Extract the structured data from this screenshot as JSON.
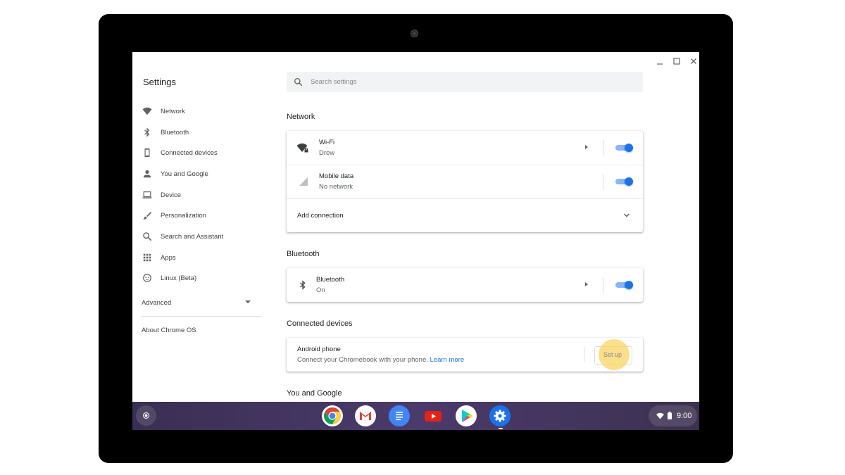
{
  "window": {
    "app_title": "Settings",
    "controls": [
      "minimize-icon",
      "maximize-icon",
      "close-icon"
    ]
  },
  "sidebar": {
    "items": [
      {
        "label": "Network",
        "icon": "wifi-icon"
      },
      {
        "label": "Bluetooth",
        "icon": "bluetooth-icon"
      },
      {
        "label": "Connected devices",
        "icon": "phone-icon"
      },
      {
        "label": "You and Google",
        "icon": "person-icon"
      },
      {
        "label": "Device",
        "icon": "laptop-icon"
      },
      {
        "label": "Personalization",
        "icon": "brush-icon"
      },
      {
        "label": "Search and Assistant",
        "icon": "search-icon"
      },
      {
        "label": "Apps",
        "icon": "apps-grid-icon"
      },
      {
        "label": "Linux (Beta)",
        "icon": "linux-icon"
      }
    ],
    "advanced_label": "Advanced",
    "about_label": "About Chrome OS"
  },
  "search": {
    "placeholder": "Search settings"
  },
  "sections": {
    "network": {
      "title": "Network",
      "wifi": {
        "title": "Wi-Fi",
        "subtitle": "Drew",
        "enabled": true
      },
      "mobile": {
        "title": "Mobile data",
        "subtitle": "No network",
        "enabled": true
      },
      "add_connection": "Add connection"
    },
    "bluetooth": {
      "title": "Bluetooth",
      "row": {
        "title": "Bluetooth",
        "subtitle": "On",
        "enabled": true
      }
    },
    "connected_devices": {
      "title": "Connected devices",
      "android": {
        "title": "Android phone",
        "subtitle": "Connect your Chromebook with your phone.",
        "link": "Learn more",
        "button": "Set up"
      }
    },
    "you_and_google": {
      "title": "You and Google"
    }
  },
  "shelf": {
    "apps": [
      "chrome-icon",
      "gmail-icon",
      "docs-icon",
      "youtube-icon",
      "play-store-icon",
      "settings-gear-icon"
    ],
    "time": "9:00",
    "colors": {
      "accent": "#1a73e8",
      "shelf": "#4b3a6c"
    }
  }
}
